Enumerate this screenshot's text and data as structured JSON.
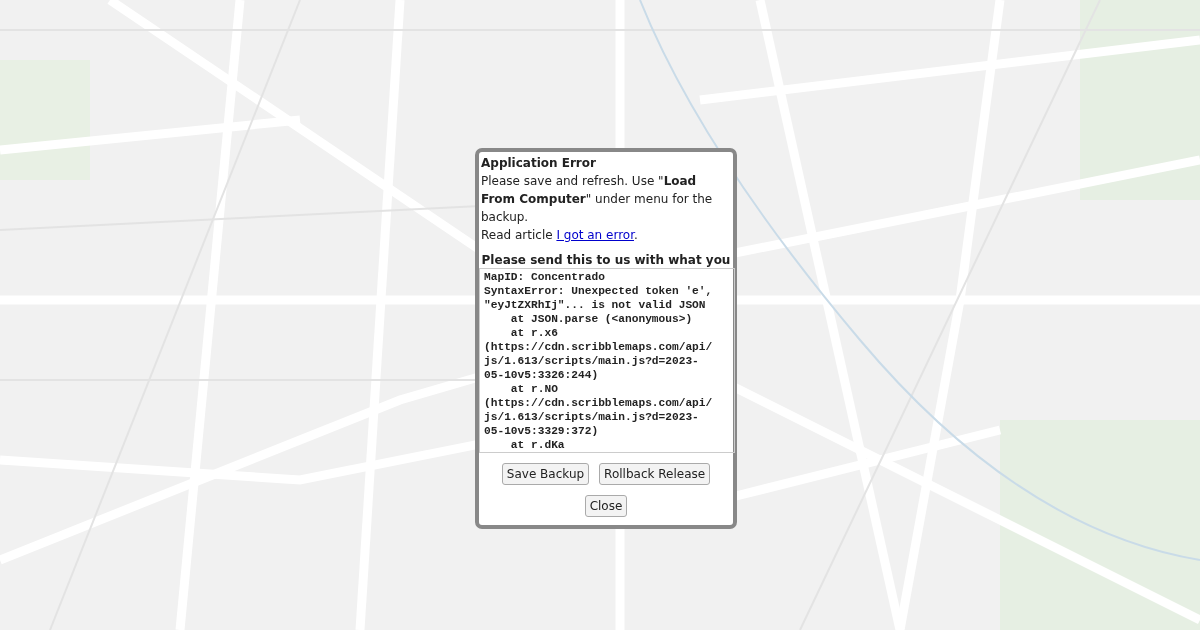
{
  "dialog": {
    "title": "Application Error",
    "message": "Please save and refresh. Use \"**Load From Computer**\" under menu for the backup.",
    "article": {
      "prefix": "Read article ",
      "link": "I got an error",
      "suffix": "."
    },
    "send_heading": "Please send this to us with what you",
    "error_log": "MapID: Concentrado\nSyntaxError: Unexpected token 'e',\n\"eyJtZXRhIj\"... is not valid JSON\n    at JSON.parse (<anonymous>)\n    at r.x6\n(https://cdn.scribblemaps.com/api/\njs/1.613/scripts/main.js?d=2023-\n05-10v5:3326:244)\n    at r.NO\n(https://cdn.scribblemaps.com/api/\njs/1.613/scripts/main.js?d=2023-\n05-10v5:3329:372)\n    at r.dKa",
    "buttons": [
      {
        "label": "Save Backup"
      },
      {
        "label": "Rollback Release"
      }
    ],
    "close_button": "Close"
  }
}
